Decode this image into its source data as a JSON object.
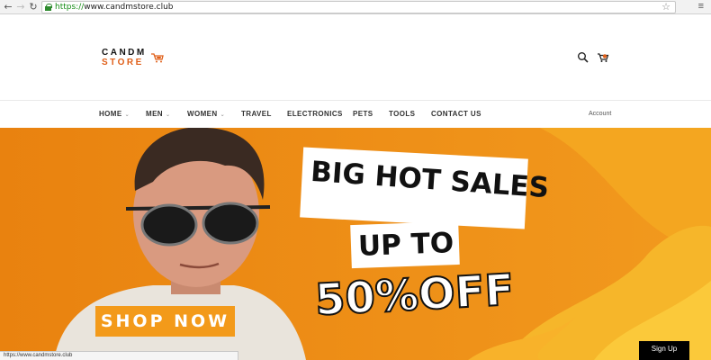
{
  "browser": {
    "url_scheme": "https://",
    "url_host": "www.candmstore.club",
    "status_url": "https://www.candmstore.club"
  },
  "logo": {
    "line1": "CANDM",
    "line2": "STORE",
    "accent_color": "#e0601a"
  },
  "header_icons": [
    "search-icon",
    "cart-icon"
  ],
  "nav": {
    "items": [
      {
        "label": "HOME",
        "dropdown": true
      },
      {
        "label": "MEN",
        "dropdown": true
      },
      {
        "label": "WOMEN",
        "dropdown": true
      },
      {
        "label": "TRAVEL",
        "dropdown": false
      },
      {
        "label": "ELECTRONICS",
        "dropdown": false
      },
      {
        "label": "PETS",
        "dropdown": false
      },
      {
        "label": "TOOLS",
        "dropdown": false
      },
      {
        "label": "CONTACT US",
        "dropdown": false
      }
    ],
    "account": "Account"
  },
  "hero": {
    "line1": "BIG HOT SALES",
    "line2": "UP TO",
    "line3": "50%OFF",
    "cta": "SHOP NOW",
    "bg_color": "#ee8b14"
  },
  "signup": "Sign Up"
}
